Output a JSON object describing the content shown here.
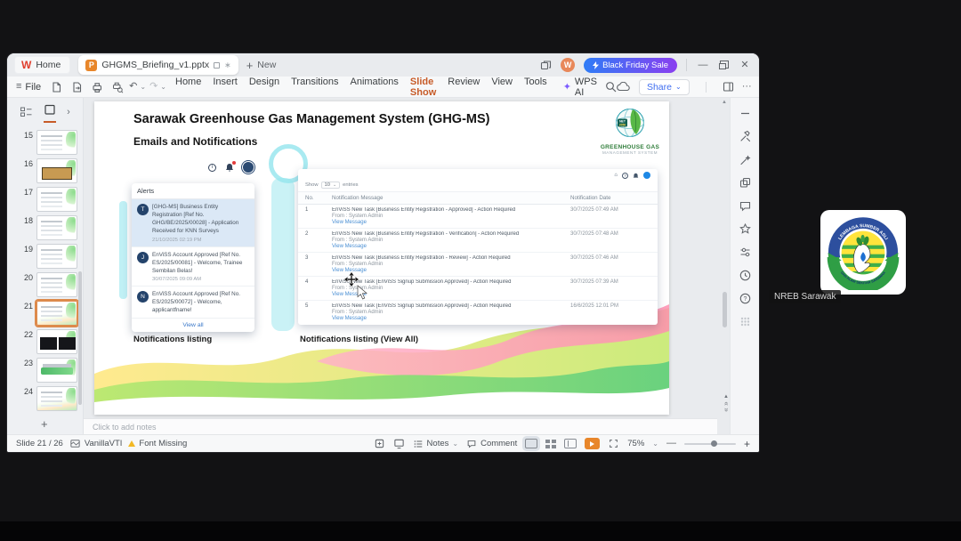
{
  "icons": {
    "menu": "≡",
    "undo": "↶",
    "redo": "↷",
    "caret": "⌄",
    "more": "···",
    "plus": "+",
    "minus": "—",
    "close": "✕",
    "chevron_right": "›",
    "asterisk": "∗",
    "up_arrow": "▲",
    "chev_up": "«",
    "chev_down": "»",
    "home": "⌂",
    "question": "?",
    "info": "i",
    "spark": "✦"
  },
  "titlebar": {
    "logo_letter": "W",
    "home_tab": "Home",
    "doc_tab": "GHGMS_Briefing_v1.pptx",
    "doc_icon_letter": "P",
    "new_label": "New",
    "avatar_letter": "W",
    "promo": "Black Friday Sale"
  },
  "menubar": {
    "file": "File",
    "items": [
      "Home",
      "Insert",
      "Design",
      "Transitions",
      "Animations",
      "Slide Show",
      "Review",
      "View",
      "Tools"
    ],
    "wps_ai": "WPS AI",
    "share": "Share"
  },
  "slide_panel": {
    "slides": [
      {
        "num": 15,
        "variant": "form",
        "selected": false
      },
      {
        "num": 16,
        "variant": "orange",
        "selected": false
      },
      {
        "num": 17,
        "variant": "form",
        "selected": false
      },
      {
        "num": 18,
        "variant": "form",
        "selected": false
      },
      {
        "num": 19,
        "variant": "form",
        "selected": false
      },
      {
        "num": 20,
        "variant": "form",
        "selected": false
      },
      {
        "num": 21,
        "variant": "wave",
        "selected": true
      },
      {
        "num": 22,
        "variant": "dark",
        "selected": false
      },
      {
        "num": 23,
        "variant": "banner",
        "selected": false
      },
      {
        "num": 24,
        "variant": "wave",
        "selected": false
      }
    ]
  },
  "slide": {
    "title": "Sarawak Greenhouse Gas Management System (GHG-MS)",
    "subtitle": "Emails and Notifications",
    "logo": {
      "chip_line1": "NET",
      "chip_line2": "2050",
      "name_line1": "GREENHOUSE GAS",
      "name_line2": "MANAGEMENT SYSTEM"
    },
    "alerts_panel": {
      "header": "Alerts",
      "items": [
        {
          "avatar": "T",
          "text": "[GHG-MS] Business Entity Registration [Ref No. GHG/BE/2025/00028] - Application Received for KNN Surveys",
          "time": "21/10/2025 02:19 PM"
        },
        {
          "avatar": "J",
          "text": "EnViSS Account Approved [Ref No. ES/2025/00081] - Welcome, Trainee Sembilan Belas!",
          "time": "30/07/2025 09:09 AM"
        },
        {
          "avatar": "N",
          "text": "EnViSS Account Approved [Ref No. ES/2025/00072] - Welcome, applicantfname!",
          "time": ""
        }
      ],
      "view_all": "View all"
    },
    "table_panel": {
      "show_label": "Show",
      "show_value": "10",
      "entries_label": "entries",
      "columns": [
        "No.",
        "Notification Message",
        "Notification Date"
      ],
      "rows": [
        {
          "no": "1",
          "message": "EnViSS New Task [Business Entity Registration - Approved] - Action Required",
          "from": "From : System Admin",
          "link": "View Message",
          "date": "30/7/2025 07:49 AM"
        },
        {
          "no": "2",
          "message": "EnViSS New Task [Business Entity Registration - Verification] - Action Required",
          "from": "From : System Admin",
          "link": "View Message",
          "date": "30/7/2025 07:48 AM"
        },
        {
          "no": "3",
          "message": "EnViSS New Task [Business Entity Registration - Review] - Action Required",
          "from": "From : System Admin",
          "link": "View Message",
          "date": "30/7/2025 07:46 AM"
        },
        {
          "no": "4",
          "message": "EnViSS New Task [EnViSS Signup Submission Approved] - Action Required",
          "from": "From : System Admin",
          "link": "View Message",
          "date": "30/7/2025 07:39 AM"
        },
        {
          "no": "5",
          "message": "EnViSS New Task [EnViSS Signup Submission Approved] - Action Required",
          "from": "From : System Admin",
          "link": "View Message",
          "date": "16/6/2025 12:01 PM"
        }
      ]
    },
    "caption_left": "Notifications listing",
    "caption_right": "Notifications listing (View All)"
  },
  "notes": {
    "placeholder": "Click to add notes"
  },
  "statusbar": {
    "slide_info": "Slide 21 / 26",
    "theme": "VanillaVTI",
    "font_missing": "Font Missing",
    "notes_label": "Notes",
    "comment_label": "Comment",
    "zoom": "75%"
  },
  "participant": {
    "label": "NREB Sarawak",
    "emblem_top": "LEMBAGA SUMBER ASLI",
    "emblem_bottom": "DAN ALAM SEKITAR SARAWAK"
  },
  "colors": {
    "accent_orange": "#c75b28",
    "promo_from": "#2f7cf6",
    "promo_to": "#8a3ff0",
    "link_blue": "#4a8fd4",
    "play_orange": "#e8862a"
  }
}
